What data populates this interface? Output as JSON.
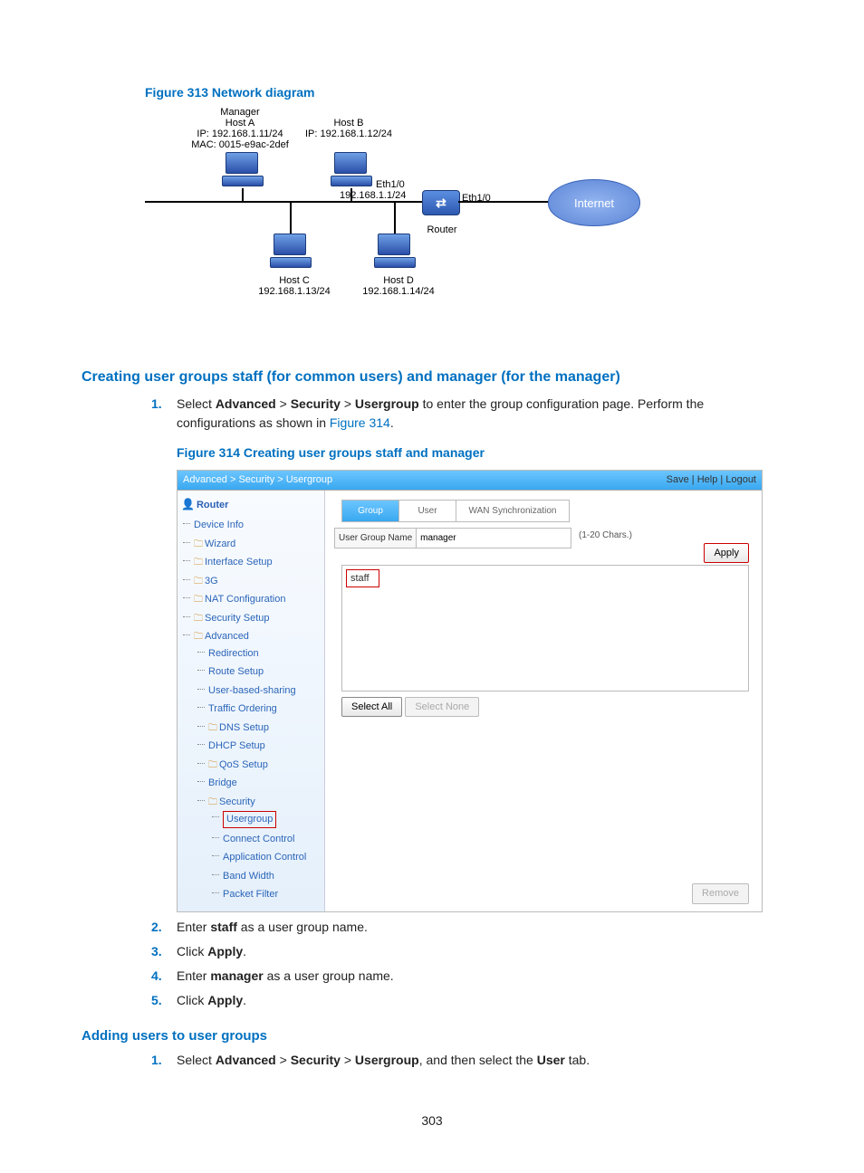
{
  "figure313_title": "Figure 313 Network diagram",
  "diagram": {
    "hostA_label1": "Manager",
    "hostA_label2": "Host A",
    "hostA_ip": "IP: 192.168.1.11/24",
    "hostA_mac": "MAC: 0015-e9ac-2def",
    "hostB_label": "Host B",
    "hostB_ip": "IP: 192.168.1.12/24",
    "hostC_label": "Host C",
    "hostC_ip": "192.168.1.13/24",
    "hostD_label": "Host D",
    "hostD_ip": "192.168.1.14/24",
    "eth10_left": "Eth1/0",
    "eth10_left_ip": "192.168.1.1/24",
    "eth10_right": "Eth1/0",
    "router_label": "Router",
    "internet_label": "Internet"
  },
  "section1_title": "Creating user groups staff (for common users) and manager (for the manager)",
  "step1_a": "Select ",
  "step1_b": "Advanced",
  "step1_c": " > ",
  "step1_d": "Security",
  "step1_e": " > ",
  "step1_f": "Usergroup",
  "step1_g": " to enter the group configuration page. Perform the configurations as shown in ",
  "step1_link": "Figure 314",
  "step1_end": ".",
  "figure314_title": "Figure 314 Creating user groups staff and manager",
  "shot": {
    "crumb": "Advanced > Security > Usergroup",
    "links": {
      "save": "Save",
      "help": "Help",
      "logout": "Logout"
    },
    "nav_root": "Router",
    "nav": {
      "device_info": "Device Info",
      "wizard": "Wizard",
      "interface_setup": "Interface Setup",
      "threeg": "3G",
      "nat": "NAT Configuration",
      "security_setup": "Security Setup",
      "advanced": "Advanced",
      "redirection": "Redirection",
      "route_setup": "Route Setup",
      "user_sharing": "User-based-sharing",
      "traffic_ordering": "Traffic Ordering",
      "dns_setup": "DNS Setup",
      "dhcp_setup": "DHCP Setup",
      "qos_setup": "QoS Setup",
      "bridge": "Bridge",
      "security": "Security",
      "usergroup": "Usergroup",
      "connect_control": "Connect Control",
      "app_control": "Application Control",
      "band_width": "Band Width",
      "packet_filter": "Packet Filter"
    },
    "tabs": {
      "group": "Group",
      "user": "User",
      "wan": "WAN Synchronization"
    },
    "form": {
      "label": "User Group Name",
      "value": "manager",
      "chars": "(1-20 Chars.)"
    },
    "apply": "Apply",
    "list_item": "staff",
    "select_all": "Select All",
    "select_none": "Select None",
    "remove": "Remove"
  },
  "step2_a": "Enter ",
  "step2_b": "staff",
  "step2_c": " as a user group name.",
  "step3_a": "Click ",
  "step3_b": "Apply",
  "step3_c": ".",
  "step4_a": "Enter ",
  "step4_b": "manager",
  "step4_c": " as a user group name.",
  "step5_a": "Click ",
  "step5_b": "Apply",
  "step5_c": ".",
  "section2_title": "Adding users to user groups",
  "sec2_step1_a": "Select ",
  "sec2_step1_b": "Advanced",
  "sec2_step1_c": " > ",
  "sec2_step1_d": "Security",
  "sec2_step1_e": " > ",
  "sec2_step1_f": "Usergroup",
  "sec2_step1_g": ", and then select the ",
  "sec2_step1_h": "User",
  "sec2_step1_i": " tab.",
  "page_number": "303"
}
